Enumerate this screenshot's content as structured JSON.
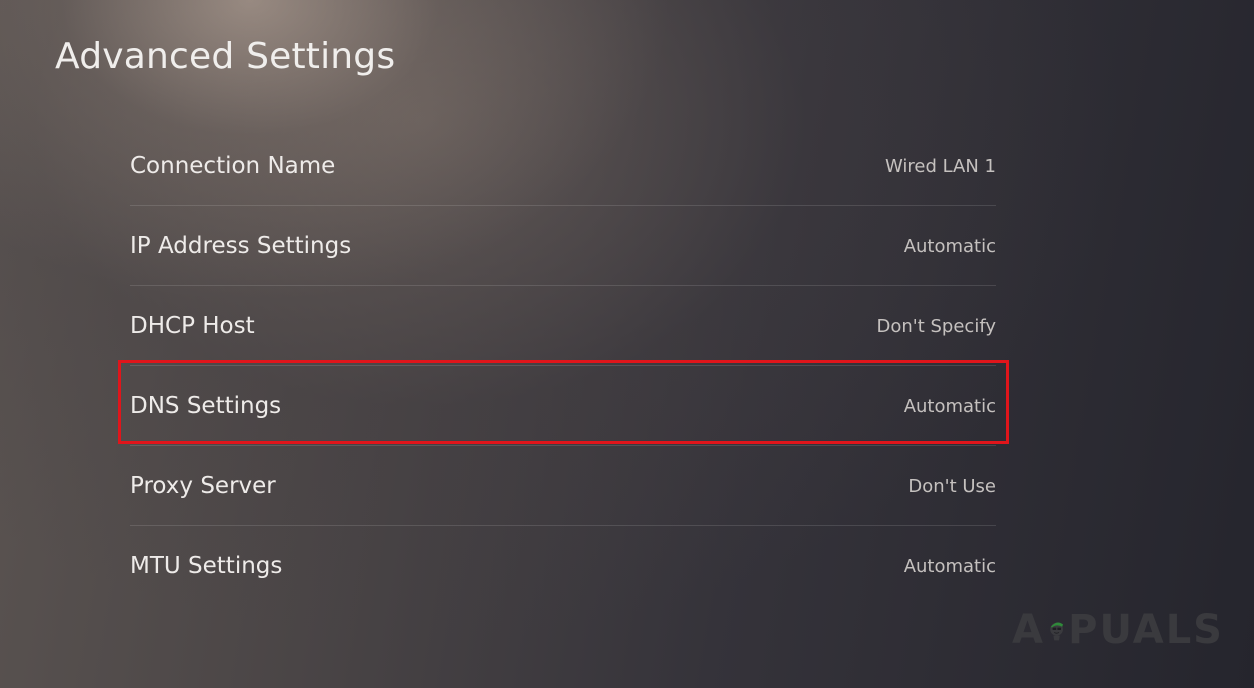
{
  "page": {
    "title": "Advanced Settings"
  },
  "settings": [
    {
      "label": "Connection Name",
      "value": "Wired LAN 1"
    },
    {
      "label": "IP Address Settings",
      "value": "Automatic"
    },
    {
      "label": "DHCP Host",
      "value": "Don't Specify"
    },
    {
      "label": "DNS Settings",
      "value": "Automatic",
      "highlighted": true
    },
    {
      "label": "Proxy Server",
      "value": "Don't Use"
    },
    {
      "label": "MTU Settings",
      "value": "Automatic"
    }
  ],
  "watermark": {
    "text_left": "A",
    "text_right": "PUALS"
  },
  "colors": {
    "highlight_border": "#e0151b"
  }
}
